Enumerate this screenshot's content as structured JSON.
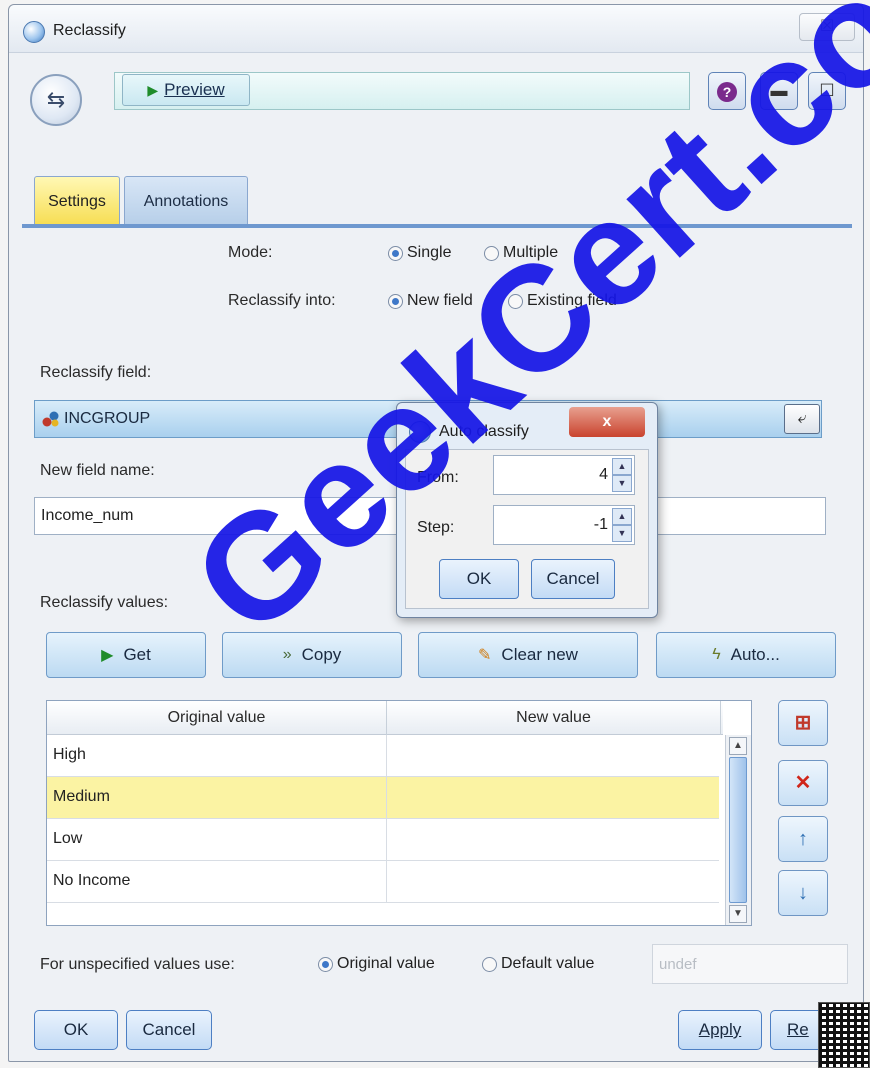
{
  "window": {
    "title": "Reclassify",
    "close_label": "☒"
  },
  "toolbar": {
    "preview_label": "Preview",
    "help_icon": "help-icon",
    "minimize_icon": "minimize-icon",
    "maximize_icon": "maximize-icon"
  },
  "tabs": [
    {
      "label": "Settings",
      "active": true
    },
    {
      "label": "Annotations",
      "active": false
    }
  ],
  "mode": {
    "label": "Mode:",
    "options": [
      {
        "label": "Single",
        "selected": true
      },
      {
        "label": "Multiple",
        "selected": false
      }
    ]
  },
  "reclassify_into": {
    "label": "Reclassify into:",
    "options": [
      {
        "label": "New field",
        "selected": true
      },
      {
        "label": "Existing field",
        "selected": false
      }
    ]
  },
  "reclassify_field": {
    "label": "Reclassify field:",
    "value": "INCGROUP"
  },
  "new_field_name": {
    "label": "New field name:",
    "value": "Income_num"
  },
  "reclassify_values": {
    "label": "Reclassify values:",
    "buttons": {
      "get": "Get",
      "copy": "Copy",
      "clear_new": "Clear new",
      "auto": "Auto..."
    }
  },
  "table": {
    "columns": [
      "Original value",
      "New value"
    ],
    "rows": [
      {
        "original": "High",
        "new": ""
      },
      {
        "original": "Medium",
        "new": "",
        "selected": true
      },
      {
        "original": "Low",
        "new": ""
      },
      {
        "original": "No Income",
        "new": ""
      }
    ]
  },
  "unspecified": {
    "label": "For unspecified values use:",
    "options": [
      {
        "label": "Original value",
        "selected": true
      },
      {
        "label": "Default value",
        "selected": false
      }
    ],
    "default_value": "undef"
  },
  "footer": {
    "ok": "OK",
    "cancel": "Cancel",
    "apply": "Apply",
    "reset": "Re"
  },
  "auto_classify": {
    "title": "Auto classify",
    "close_label": "x",
    "from_label": "From:",
    "from_value": "4",
    "step_label": "Step:",
    "step_value": "-1",
    "ok": "OK",
    "cancel": "Cancel"
  },
  "watermark": "GeekCert.com",
  "colors": {
    "accent": "#3f78c8",
    "selected_row": "#fbf3a3",
    "tab_active": "#f7de55",
    "watermark": "#1616e6"
  }
}
